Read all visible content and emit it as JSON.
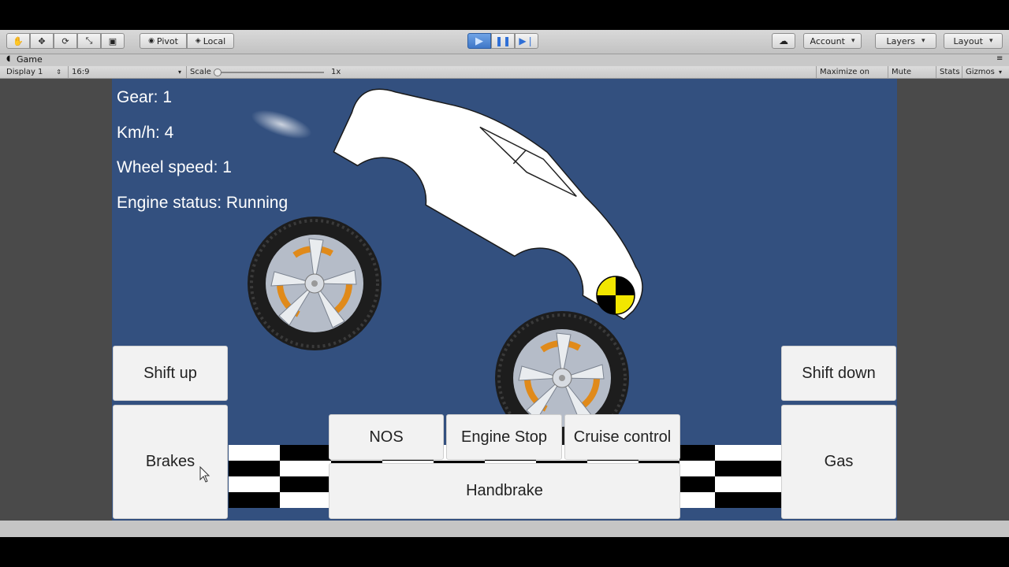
{
  "toolbar": {
    "pivot_label": "Pivot",
    "local_label": "Local",
    "account_label": "Account",
    "layers_label": "Layers",
    "layout_label": "Layout"
  },
  "game_window": {
    "tab_label": "Game",
    "display_label": "Display 1",
    "aspect_label": "16:9",
    "scale_label": "Scale",
    "scale_value": "1x",
    "maximize_label": "Maximize on Play",
    "mute_label": "Mute audio",
    "stats_label": "Stats",
    "gizmos_label": "Gizmos"
  },
  "hud": {
    "gear": "Gear: 1",
    "speed": "Km/h: 4",
    "wheel_speed": "Wheel speed: 1",
    "engine_status": "Engine status: Running"
  },
  "controls": {
    "shift_up": "Shift up",
    "shift_down": "Shift down",
    "brakes": "Brakes",
    "gas": "Gas",
    "nos": "NOS",
    "engine_stop": "Engine Stop",
    "cruise_control": "Cruise control",
    "handbrake": "Handbrake"
  },
  "colors": {
    "game_background": "#33507f",
    "play_active": "#3f77c7",
    "crash_marker": "#f2e600"
  }
}
